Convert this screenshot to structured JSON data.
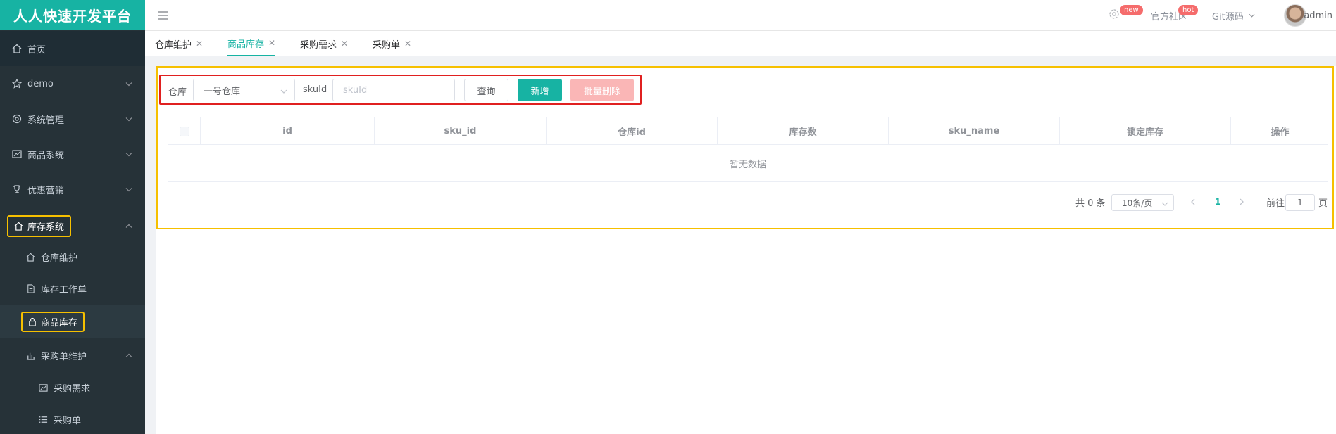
{
  "app": {
    "title": "人人快速开发平台"
  },
  "sidebar": {
    "items": [
      {
        "label": "首页"
      },
      {
        "label": "demo"
      },
      {
        "label": "系统管理"
      },
      {
        "label": "商品系统"
      },
      {
        "label": "优惠营销"
      },
      {
        "label": "库存系统"
      },
      {
        "label": "仓库维护"
      },
      {
        "label": "库存工作单"
      },
      {
        "label": "商品库存"
      },
      {
        "label": "采购单维护"
      },
      {
        "label": "采购需求"
      },
      {
        "label": "采购单"
      }
    ]
  },
  "header": {
    "settings_badge": "new",
    "community_label": "官方社区",
    "community_badge": "hot",
    "git_label": "Git源码",
    "user_name": "admin"
  },
  "tabs": [
    {
      "label": "仓库维护"
    },
    {
      "label": "商品库存"
    },
    {
      "label": "采购需求"
    },
    {
      "label": "采购单"
    }
  ],
  "filter": {
    "warehouse_label": "仓库",
    "warehouse_value": "一号仓库",
    "sku_label": "skuId",
    "sku_placeholder": "skuId",
    "query_button": "查询",
    "add_button": "新增",
    "batch_delete_button": "批量删除"
  },
  "table": {
    "columns": [
      "id",
      "sku_id",
      "仓库id",
      "库存数",
      "sku_name",
      "锁定库存",
      "操作"
    ],
    "empty_text": "暂无数据"
  },
  "pagination": {
    "total_text": "共 0 条",
    "page_size": "10条/页",
    "current_page": "1",
    "goto_label": "前往",
    "goto_value": "1",
    "page_suffix": "页"
  },
  "colors": {
    "primary": "#17b3a3",
    "danger_disabled": "#fab6b6",
    "sidebar_bg": "#263238",
    "highlight_yellow": "#f6c000",
    "highlight_red": "#e02020"
  }
}
